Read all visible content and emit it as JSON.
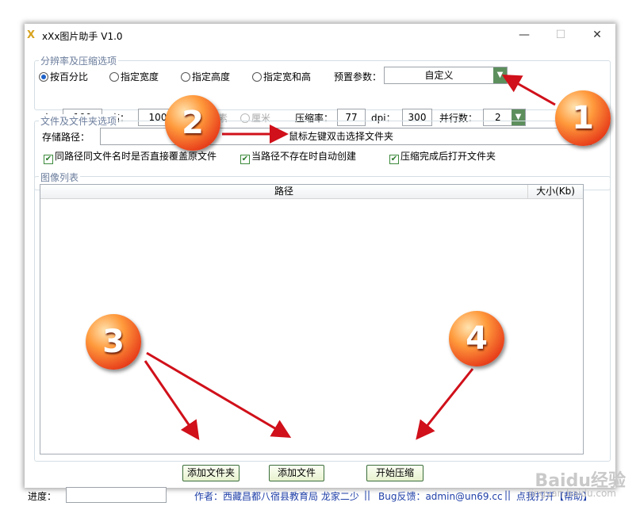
{
  "window": {
    "title": "xXx图片助手 V1.0",
    "icon_glyph": "X",
    "controls": {
      "minimize": "—",
      "maximize": "☐",
      "close": "✕"
    }
  },
  "resolution": {
    "legend": "分辨率及压缩选项",
    "radios": [
      {
        "label": "按百分比",
        "checked": true
      },
      {
        "label": "指定宽度",
        "checked": false
      },
      {
        "label": "指定高度",
        "checked": false
      },
      {
        "label": "指定宽和高",
        "checked": false
      }
    ],
    "preset_label": "预置参数：",
    "preset_value": "自定义",
    "width_label": "宽：",
    "width_value": "100",
    "height_label": "高：",
    "height_value": "100",
    "unit_pixel": "像素",
    "unit_cm": "厘米",
    "compress_label": "压缩率：",
    "compress_value": "77",
    "dpi_label": "dpi：",
    "dpi_value": "300",
    "threads_label": "并行数：",
    "threads_value": "2"
  },
  "files": {
    "legend": "文件及文件夹选项",
    "path_label": "存储路径：",
    "path_placeholder": "鼠标左键双击选择文件夹",
    "options": [
      {
        "label": "同路径同文件名时是否直接覆盖原文件",
        "checked": true
      },
      {
        "label": "当路径不存在时自动创建",
        "checked": true
      },
      {
        "label": "压缩完成后打开文件夹",
        "checked": true
      }
    ]
  },
  "image_list": {
    "legend": "图像列表",
    "columns": [
      "路径",
      "大小(Kb)"
    ]
  },
  "buttons": {
    "add_folder": "添加文件夹",
    "add_file": "添加文件",
    "start": "开始压缩"
  },
  "status": {
    "progress_label": "进度：",
    "author": "作者：西藏昌都八宿县教育局 龙家二少",
    "sep1": "||",
    "bug": "Bug反馈：admin@un69.cc",
    "sep2": "||",
    "help": "点我打开【帮助】"
  },
  "annotations": [
    "1",
    "2",
    "3",
    "4"
  ],
  "watermark": {
    "brand": "Baidu经验",
    "site": "jingyan.baidu.com"
  },
  "colors": {
    "legend": "#6b7d9c",
    "link": "#1f3fa8",
    "bubble": "#e8401b",
    "arrow": "#d0101a"
  }
}
